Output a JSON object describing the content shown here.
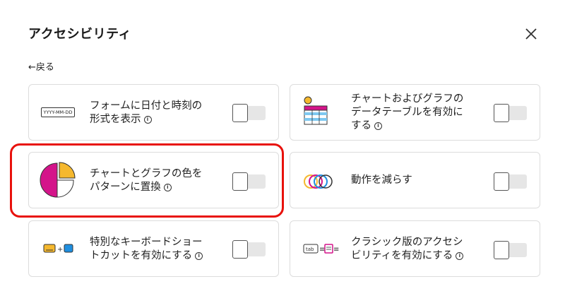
{
  "dialog": {
    "title": "アクセシビリティ",
    "back_label": "←戻る"
  },
  "cards": [
    {
      "label_line1": "フォームに日付と時刻の",
      "label_line2": "形式を表示",
      "icon_text": "YYYY-MM-DD",
      "icon": "date-format-icon",
      "enabled": false
    },
    {
      "label_line1": "チャートおよびグラフの",
      "label_line2": "データテーブルを有効に",
      "label_line3": "する",
      "icon": "data-table-icon",
      "enabled": false
    },
    {
      "label_line1": "チャートとグラフの色を",
      "label_line2": "パターンに置換",
      "icon": "pie-pattern-icon",
      "enabled": false
    },
    {
      "label_line1": "動作を減らす",
      "icon": "reduce-motion-icon",
      "enabled": false
    },
    {
      "label_line1": "特別なキーボードショー",
      "label_line2": "トカットを有効にする",
      "icon": "keyboard-shortcut-icon",
      "enabled": false
    },
    {
      "label_line1": "クラシック版のアクセシ",
      "label_line2": "ビリティを有効にする",
      "icon_text": "tab",
      "icon": "classic-accessibility-icon",
      "enabled": false
    }
  ],
  "colors": {
    "highlight": "#e8110c",
    "accent_yellow": "#f5b82e",
    "accent_magenta": "#d4148a",
    "accent_blue": "#1f8fe0"
  }
}
